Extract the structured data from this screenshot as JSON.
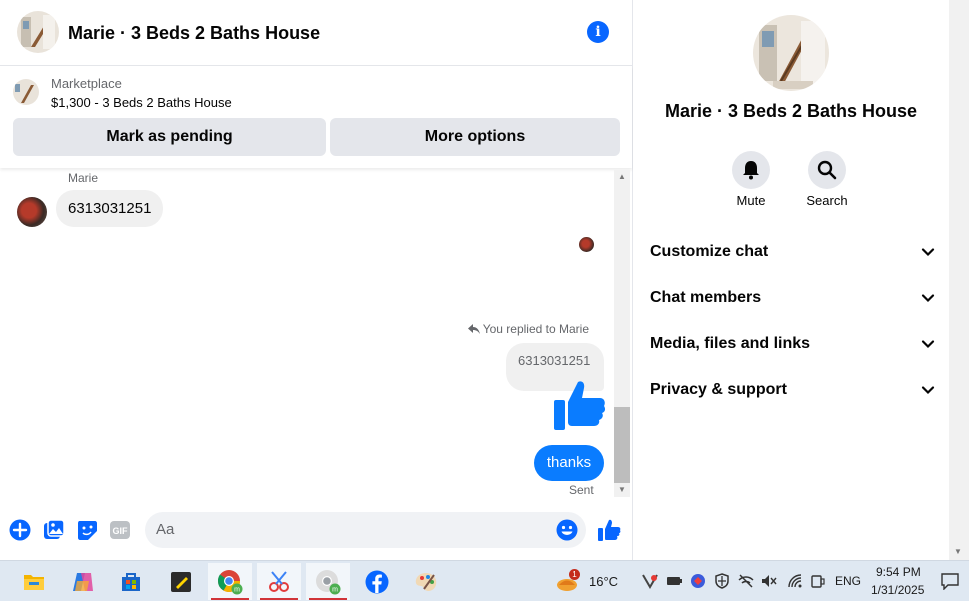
{
  "chat": {
    "title": "Marie · 3 Beds 2 Baths House",
    "marketplace_label": "Marketplace",
    "listing": "$1,300 - 3 Beds 2 Baths House",
    "mark_pending_label": "Mark as pending",
    "more_options_label": "More options",
    "sender_name": "Marie",
    "incoming_message": "6313031251",
    "replied_label": "You replied to Marie",
    "replied_quote": "6313031251",
    "outgoing_message": "thanks",
    "sent_status": "Sent",
    "composer_placeholder": "Aa"
  },
  "info_panel": {
    "name": "Marie · 3 Beds 2 Baths House",
    "actions": [
      {
        "label": "Mute",
        "icon": "bell-icon"
      },
      {
        "label": "Search",
        "icon": "search-icon"
      }
    ],
    "sections": [
      {
        "label": "Customize chat"
      },
      {
        "label": "Chat members"
      },
      {
        "label": "Media, files and links"
      },
      {
        "label": "Privacy & support"
      }
    ]
  },
  "taskbar": {
    "apps": [
      "file-explorer-icon",
      "copilot-icon",
      "store-icon",
      "sticky-notes-icon",
      "chrome-icon",
      "snipping-tool-icon",
      "chrome-profile-icon",
      "facebook-icon",
      "paint-icon"
    ],
    "weather_badge": "1",
    "temperature": "16°C",
    "language": "ENG",
    "time": "9:54 PM",
    "date": "1/31/2025"
  },
  "colors": {
    "accent": "#0866ff",
    "bubble_out": "#0a7cff",
    "bubble_in": "#f0f0f0",
    "button_bg": "#e4e6eb"
  }
}
